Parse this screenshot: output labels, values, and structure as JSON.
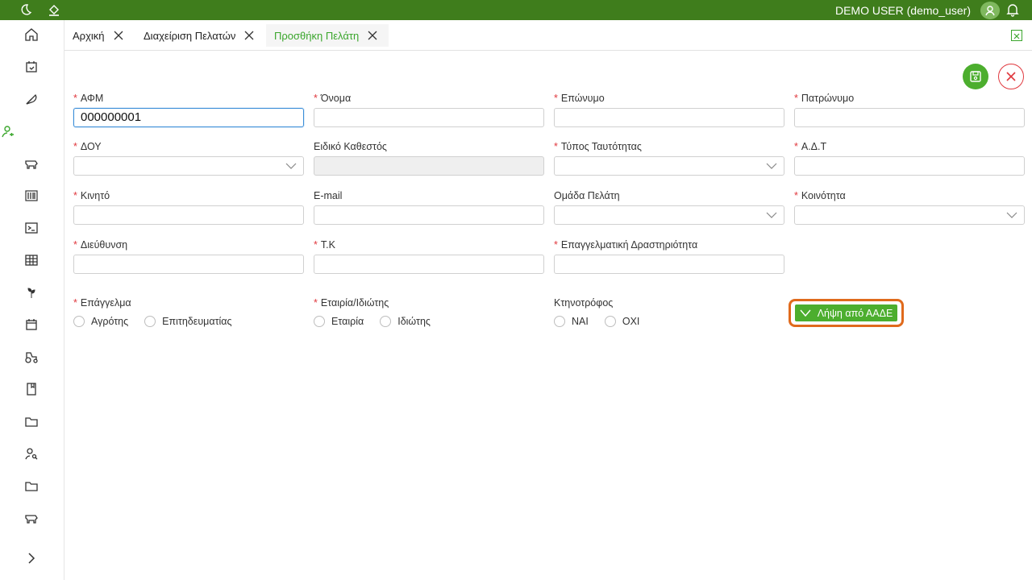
{
  "topbar": {
    "user_label": "DEMO USER (demo_user)",
    "accent": "#3f7d1c"
  },
  "tabs": [
    {
      "label": "Αρχική"
    },
    {
      "label": "Διαχείριση Πελατών"
    },
    {
      "label": "Προσθήκη Πελάτη"
    }
  ],
  "form": {
    "afm": {
      "label": "ΑΦΜ",
      "value": "000000001"
    },
    "onoma": {
      "label": "Όνομα",
      "value": ""
    },
    "eponymo": {
      "label": "Επώνυμο",
      "value": ""
    },
    "patronymo": {
      "label": "Πατρώνυμο",
      "value": ""
    },
    "doy": {
      "label": "ΔΟΥ",
      "value": ""
    },
    "eidiko": {
      "label": "Ειδικό Καθεστός",
      "value": ""
    },
    "typos": {
      "label": "Τύπος Ταυτότητας",
      "value": ""
    },
    "adt": {
      "label": "Α.Δ.Τ",
      "value": ""
    },
    "kinito": {
      "label": "Κινητό",
      "value": ""
    },
    "email": {
      "label": "E-mail",
      "value": ""
    },
    "omada": {
      "label": "Ομάδα Πελάτη",
      "value": ""
    },
    "koinotita": {
      "label": "Κοινότητα",
      "value": ""
    },
    "dieuthinsi": {
      "label": "Διεύθυνση",
      "value": ""
    },
    "tk": {
      "label": "Τ.Κ",
      "value": ""
    },
    "drastiriotita": {
      "label": "Επαγγελματική Δραστηριότητα",
      "value": ""
    },
    "epaggelma": {
      "label": "Επάγγελμα",
      "options": [
        "Αγρότης",
        "Επιτηδευματίας"
      ]
    },
    "etairia": {
      "label": "Εταιρία/Ιδιώτης",
      "options": [
        "Εταιρία",
        "Ιδιώτης"
      ]
    },
    "ktinotrofos": {
      "label": "Κτηνοτρόφος",
      "options": [
        "ΝΑΙ",
        "ΟΧΙ"
      ]
    },
    "required_marker": "*"
  },
  "actions": {
    "aade_label": "Λήψη από ΑΑΔΕ"
  },
  "colors": {
    "green": "#4cae2e",
    "red": "#e0383e",
    "highlight": "#e06a1c"
  }
}
